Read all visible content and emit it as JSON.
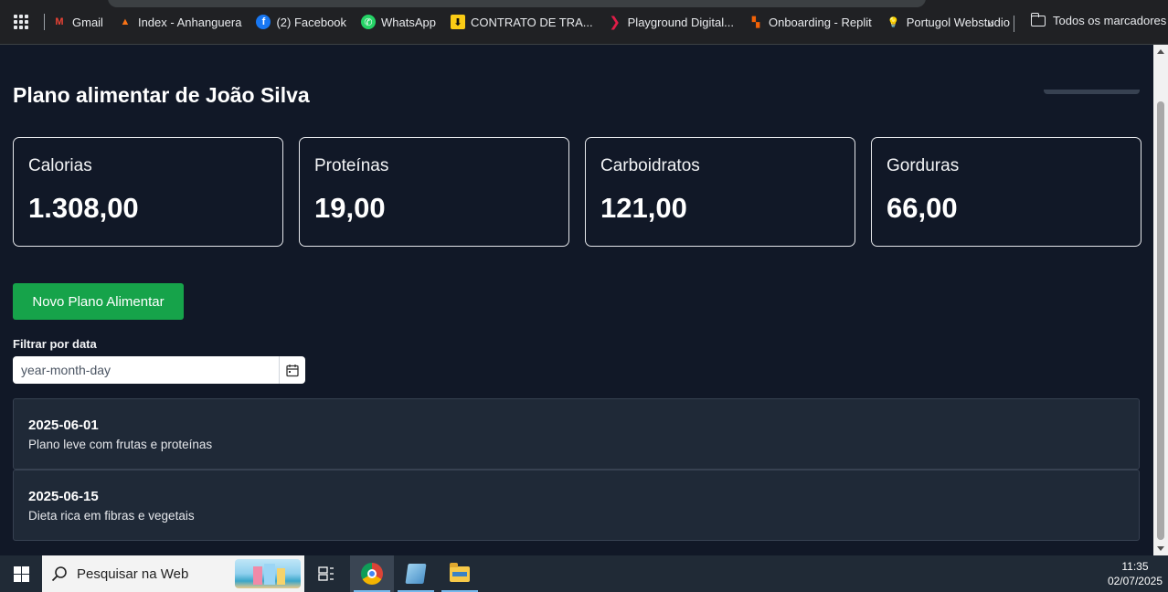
{
  "bookmarks": {
    "items": [
      {
        "label": "Gmail",
        "icon": "gmail-icon"
      },
      {
        "label": "Index - Anhanguera",
        "icon": "anhanguera-icon"
      },
      {
        "label": "(2) Facebook",
        "icon": "facebook-icon"
      },
      {
        "label": "WhatsApp",
        "icon": "whatsapp-icon"
      },
      {
        "label": "CONTRATO DE TRA...",
        "icon": "download-icon"
      },
      {
        "label": "Playground Digital...",
        "icon": "playground-icon"
      },
      {
        "label": "Onboarding - Replit",
        "icon": "replit-icon"
      },
      {
        "label": "Portugol Webstudio",
        "icon": "lightbulb-icon"
      }
    ],
    "more": "»",
    "all_bookmarks": "Todos os marcadores"
  },
  "page": {
    "title": "Plano alimentar de João Silva",
    "cards": [
      {
        "label": "Calorias",
        "value": "1.308,00"
      },
      {
        "label": "Proteínas",
        "value": "19,00"
      },
      {
        "label": "Carboidratos",
        "value": "121,00"
      },
      {
        "label": "Gorduras",
        "value": "66,00"
      }
    ],
    "new_plan_button": "Novo Plano Alimentar",
    "filter_label": "Filtrar por data",
    "date_placeholder": "year-month-day",
    "plans": [
      {
        "date": "2025-06-01",
        "description": "Plano leve com frutas e proteínas"
      },
      {
        "date": "2025-06-15",
        "description": "Dieta rica em fibras e vegetais"
      }
    ]
  },
  "taskbar": {
    "search_placeholder": "Pesquisar na Web",
    "time": "11:35",
    "date": "02/07/2025"
  },
  "colors": {
    "background": "#111827",
    "primary_button": "#16a34a",
    "plan_card": "#1f2937"
  }
}
